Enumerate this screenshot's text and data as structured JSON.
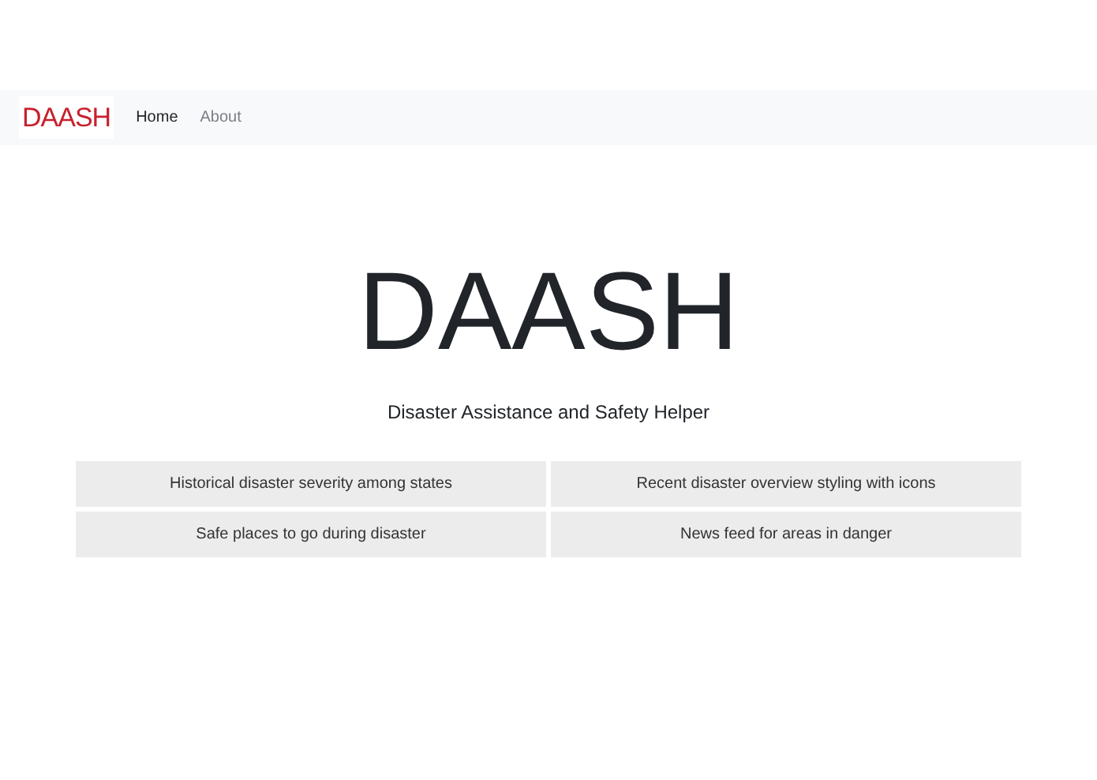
{
  "navbar": {
    "logo": "DAASH",
    "links": [
      {
        "label": "Home",
        "selected": true
      },
      {
        "label": "About",
        "selected": false
      }
    ]
  },
  "hero": {
    "title": "DAASH",
    "subtitle": "Disaster Assistance and Safety Helper"
  },
  "features": [
    "Historical disaster severity among states",
    "Recent disaster overview styling with icons",
    "Safe places to go during disaster",
    "News feed for areas in danger"
  ]
}
